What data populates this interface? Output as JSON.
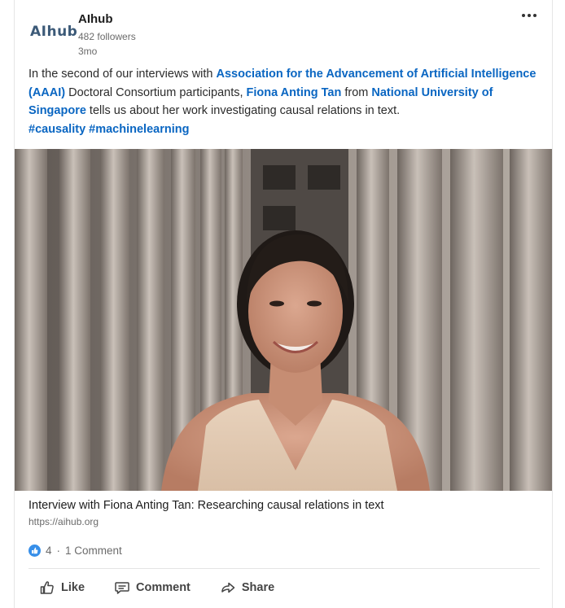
{
  "author": {
    "logo_text": "AIhub",
    "name": "AIhub",
    "followers": "482 followers",
    "time": "3mo"
  },
  "post": {
    "text_parts": [
      {
        "text": "In the second of our interviews with ",
        "link": false
      },
      {
        "text": "Association for the Advancement of Artificial Intelligence (AAAI)",
        "link": true
      },
      {
        "text": " Doctoral Consortium participants, ",
        "link": false
      },
      {
        "text": "Fiona Anting Tan",
        "link": true
      },
      {
        "text": " from ",
        "link": false
      },
      {
        "text": "National University of Singapore",
        "link": true
      },
      {
        "text": " tells us about her work investigating causal relations in text.",
        "link": false
      }
    ],
    "hashtags": "#causality #machinelearning"
  },
  "preview": {
    "title": "Interview with Fiona Anting Tan: Researching causal relations in text",
    "url": "https://aihub.org"
  },
  "social": {
    "reactions": "4",
    "separator": "·",
    "comments": "1 Comment"
  },
  "actions": {
    "like": "Like",
    "comment": "Comment",
    "share": "Share"
  },
  "colors": {
    "link": "#0a66c2",
    "like_badge": "#378fe9",
    "logo": "#3c5a78"
  }
}
